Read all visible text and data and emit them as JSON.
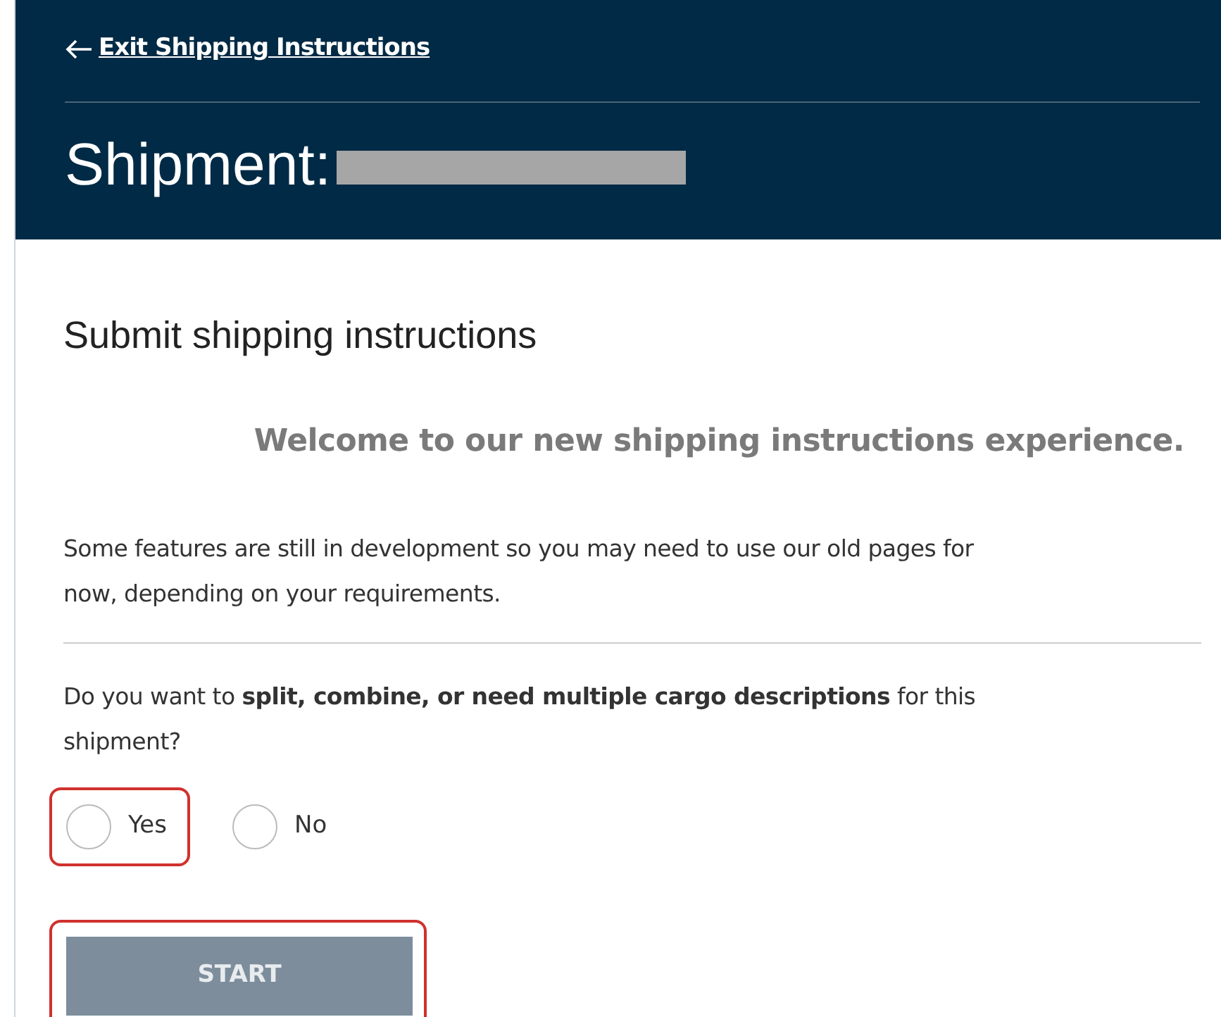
{
  "header": {
    "back_link": "Exit Shipping Instructions",
    "title": "Shipment:",
    "redacted": true
  },
  "heading": "Submit shipping instructions",
  "welcome": "Welcome to our new shipping instructions experience.",
  "intro": "Some features are still in development so you may need to use our old pages for now, depending on your requirements.",
  "question": "Do you want to **split, combine, or need multiple cargo descriptions** for this shipment?",
  "options": [
    {
      "label": "Yes",
      "selected": false,
      "highlighted": true
    },
    {
      "label": "No",
      "selected": false,
      "highlighted": false
    }
  ],
  "start_button": {
    "label": "START",
    "disabled": true,
    "highlighted": true
  }
}
